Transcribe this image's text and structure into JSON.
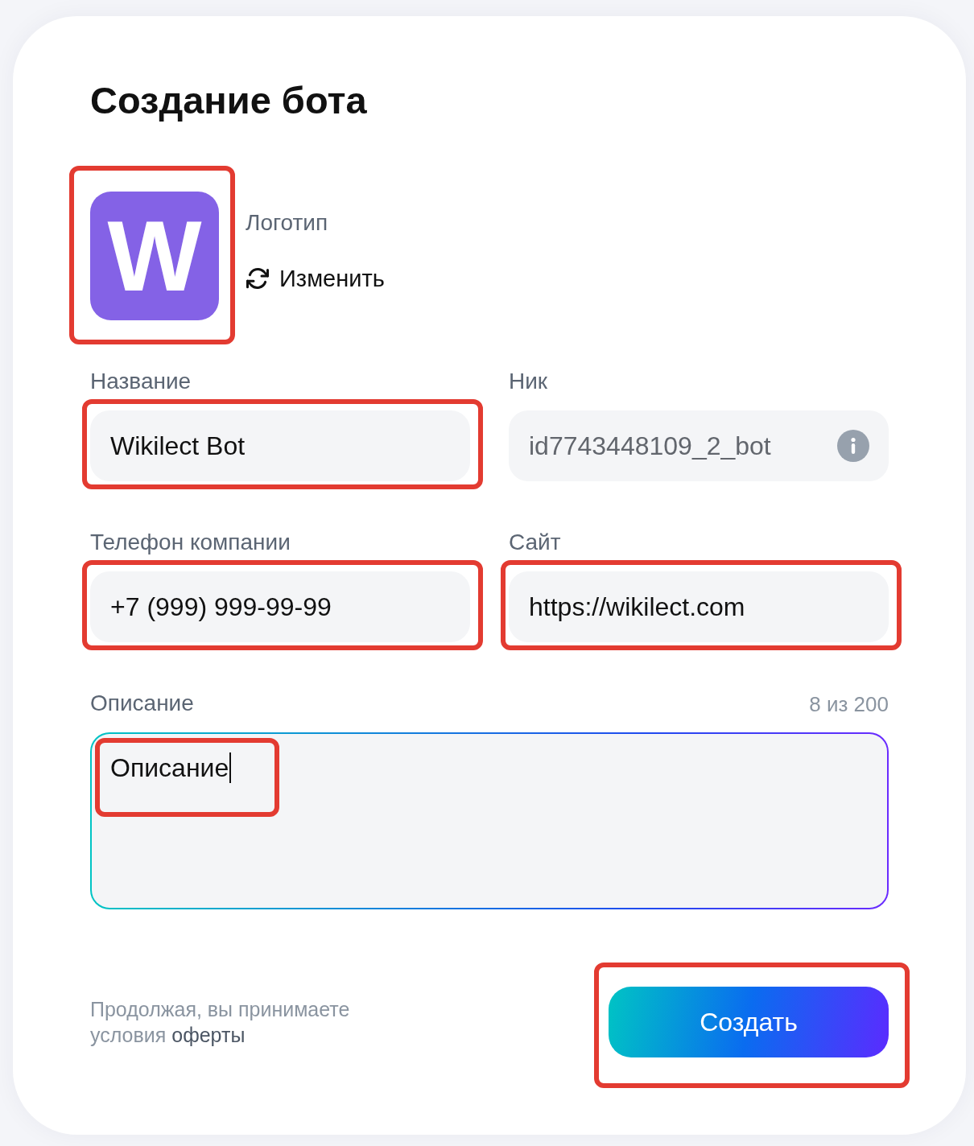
{
  "title": "Создание бота",
  "logo": {
    "letter": "W",
    "label": "Логотип",
    "change_button": "Изменить",
    "highlighted": true
  },
  "fields": [
    {
      "label": "Название",
      "value": "Wikilect Bot",
      "disabled": false,
      "info": false,
      "highlighted": true
    },
    {
      "label": "Ник",
      "value": "id7743448109_2_bot",
      "disabled": true,
      "info": true,
      "highlighted": false
    },
    {
      "label": "Телефон компании",
      "value": "+7 (999) 999-99-99",
      "disabled": false,
      "info": false,
      "highlighted": true
    },
    {
      "label": "Сайт",
      "value": "https://wikilect.com",
      "disabled": false,
      "info": false,
      "highlighted": true
    }
  ],
  "description": {
    "label": "Описание",
    "counter": "8 из 200",
    "value": "Описание",
    "focused": true,
    "highlighted": true
  },
  "consent": {
    "text": "Продолжая, вы принимаете условия",
    "link": "оферты"
  },
  "submit": {
    "label": "Создать",
    "highlighted": true
  }
}
